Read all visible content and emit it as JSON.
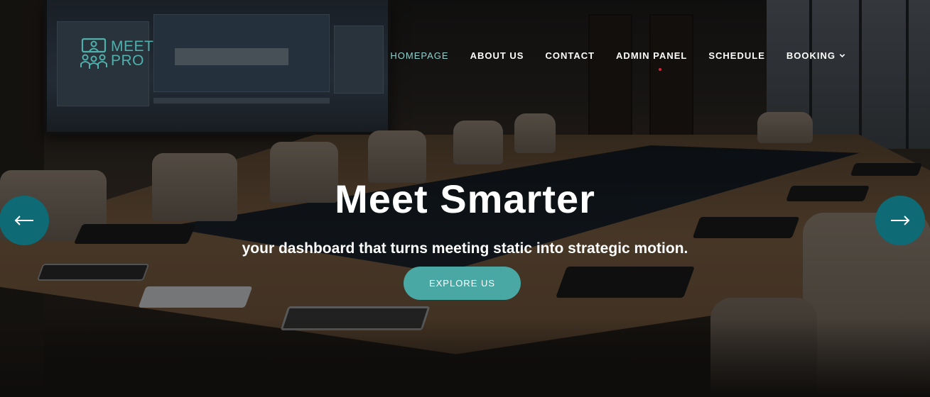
{
  "brand": {
    "logo_line1": "MEET",
    "logo_line2": "PRO",
    "accent_color": "#4fb0ac"
  },
  "nav": {
    "items": [
      {
        "label": "HOMEPAGE",
        "active": true
      },
      {
        "label": "ABOUT US",
        "active": false
      },
      {
        "label": "CONTACT",
        "active": false
      },
      {
        "label": "ADMIN PANEL",
        "active": false
      },
      {
        "label": "SCHEDULE",
        "active": false
      },
      {
        "label": "BOOKING",
        "active": false,
        "dropdown": true,
        "icon": "chevron-down-icon"
      }
    ]
  },
  "hero": {
    "title": "Meet Smarter",
    "subtitle": "your dashboard that turns meeting static into strategic motion.",
    "cta_label": "EXPLORE US",
    "cta_color": "#49a8a4",
    "prev_icon": "arrow-left-icon",
    "next_icon": "arrow-right-icon",
    "arrow_color": "#0e6a74"
  }
}
